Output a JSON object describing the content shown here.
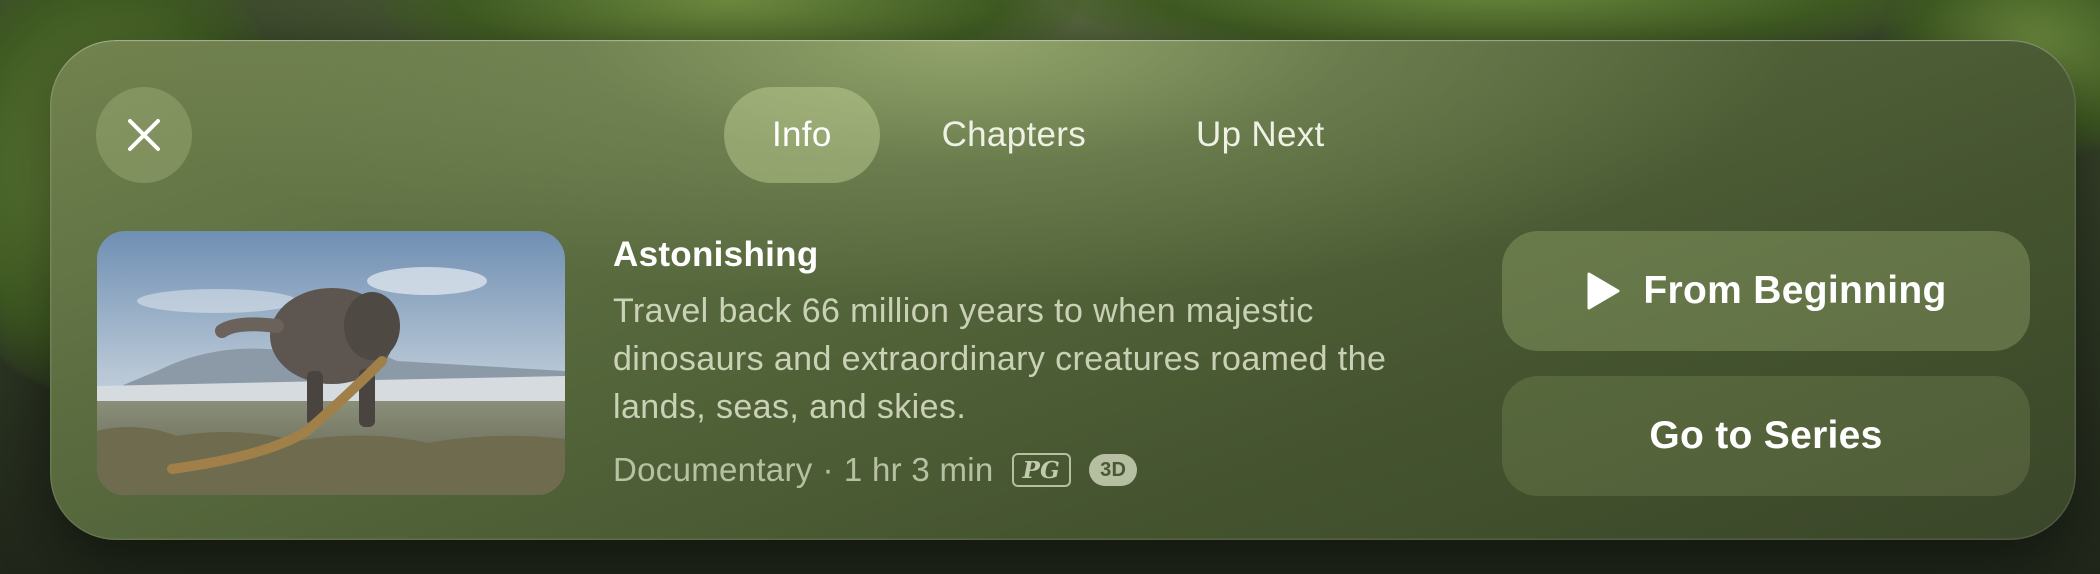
{
  "tabs": [
    {
      "label": "Info",
      "active": true
    },
    {
      "label": "Chapters",
      "active": false
    },
    {
      "label": "Up Next",
      "active": false
    }
  ],
  "icons": {
    "close": "close-icon",
    "play": "play-icon"
  },
  "content": {
    "title": "Astonishing",
    "description": "Travel back 66 million years to when majestic dinosaurs and extraordinary creatures roamed the lands, seas, and skies.",
    "genre": "Documentary",
    "separator": "·",
    "duration": "1 hr 3 min",
    "rating": "PG",
    "format_badge": "3D"
  },
  "actions": {
    "primary_label": "From Beginning",
    "secondary_label": "Go to Series"
  },
  "colors": {
    "panel": "#586a3e",
    "text_primary": "#ffffff",
    "text_secondary": "#e8eed6"
  }
}
